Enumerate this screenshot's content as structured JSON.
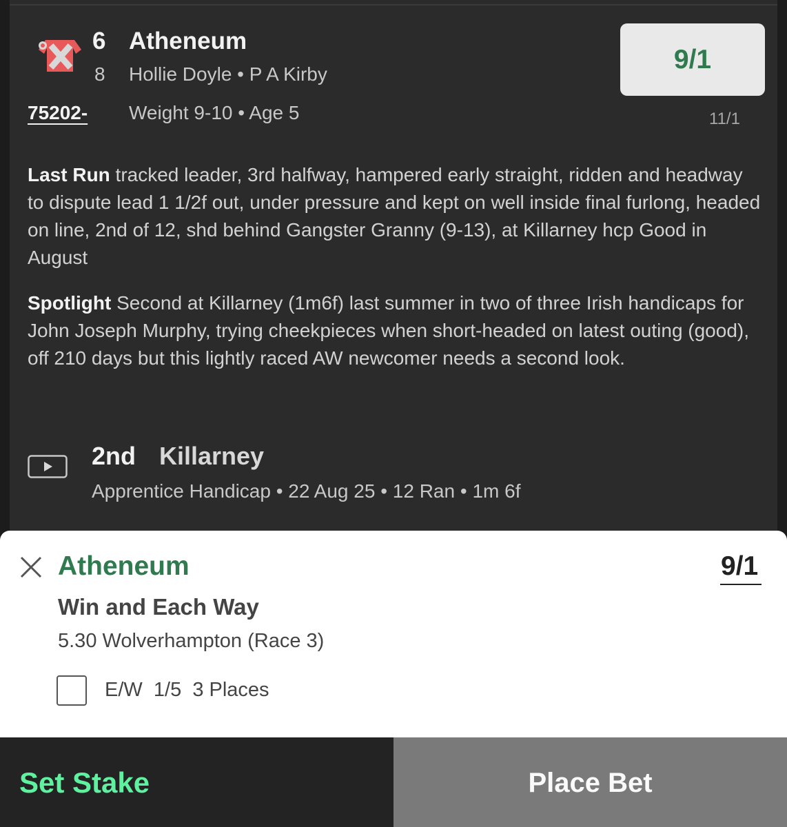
{
  "runner": {
    "number": "6",
    "name": "Atheneum",
    "draw": "8",
    "jockey_trainer": "Hollie Doyle • P A Kirby",
    "form": "75202-",
    "weight_age": "Weight 9-10 • Age 5",
    "odds": "9/1",
    "previous_odds": "11/1"
  },
  "last_run": {
    "label": "Last Run",
    "text": " tracked leader, 3rd halfway, hampered early straight, ridden and headway to dispute lead 1 1/2f out, under pressure and kept on well inside final furlong, headed on line, 2nd of 12, shd behind Gangster Granny (9-13), at Killarney hcp Good in August"
  },
  "spotlight": {
    "label": "Spotlight",
    "text": " Second at Killarney (1m6f) last summer in two of three Irish handicaps for John Joseph Murphy, trying cheekpieces when short-headed on latest outing (good), off 210 days but this lightly raced AW newcomer needs a second look."
  },
  "previous_race": {
    "position": "2nd",
    "course": "Killarney",
    "meta": "Apprentice Handicap • 22 Aug 25 • 12 Ran • 1m 6f"
  },
  "bet_slip": {
    "selection": "Atheneum",
    "odds": "9/1",
    "bet_type": "Win and Each Way",
    "race": "5.30 Wolverhampton (Race 3)",
    "each_way_label": "E/W  1/5  3 Places",
    "each_way_checked": false
  },
  "actions": {
    "set_stake": "Set Stake",
    "place_bet": "Place Bet"
  },
  "colors": {
    "accent_green": "#2f7a4f",
    "stake_green": "#5ff0a0",
    "card_bg": "#2b2b2b"
  }
}
